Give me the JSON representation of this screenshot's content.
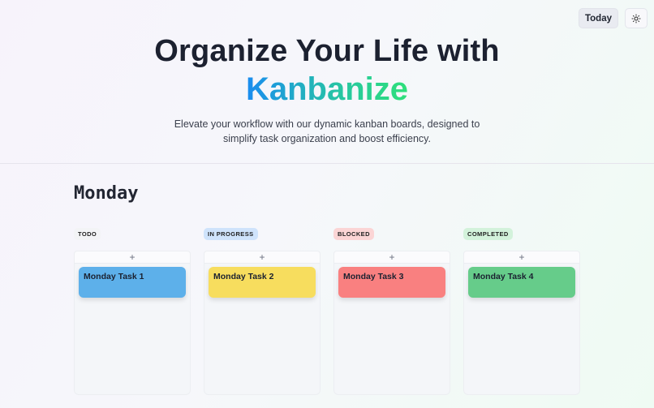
{
  "header": {
    "today_label": "Today",
    "theme_icon": "sun-icon"
  },
  "hero": {
    "title_line1": "Organize Your Life with",
    "brand": "Kanbanize",
    "tagline_line1": "Elevate your workflow with our dynamic kanban boards, designed to",
    "tagline_line2": "simplify task organization and boost efficiency."
  },
  "board": {
    "day": "Monday",
    "add_symbol": "+",
    "columns": [
      {
        "label": "TODO",
        "pill_color": "#f3f4f6",
        "card": "Monday Task 1",
        "card_color": "#5db0ea"
      },
      {
        "label": "IN PROGRESS",
        "pill_color": "#cfe3fb",
        "card": "Monday Task 2",
        "card_color": "#f7dd5e"
      },
      {
        "label": "BLOCKED",
        "pill_color": "#fbd5d5",
        "card": "Monday Task 3",
        "card_color": "#f98080"
      },
      {
        "label": "COMPLETED",
        "pill_color": "#d3f2db",
        "card": "Monday Task 4",
        "card_color": "#66cc8a"
      }
    ]
  },
  "colors": {
    "brand_gradient_start": "#1a8cf0",
    "brand_gradient_end": "#2fe07a"
  }
}
